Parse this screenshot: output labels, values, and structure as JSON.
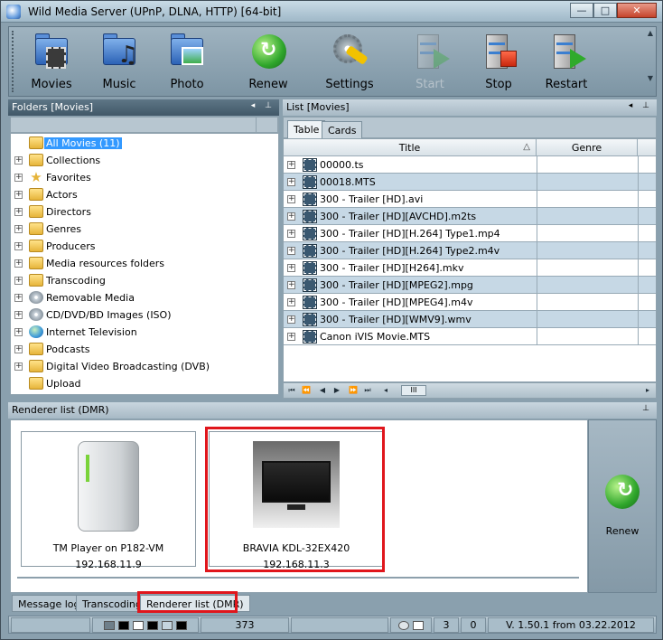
{
  "window": {
    "title": "Wild Media Server (UPnP, DLNA, HTTP) [64-bit]",
    "controls": {
      "minimize": "—",
      "maximize": "□",
      "close": "✕"
    }
  },
  "toolbar": {
    "buttons": [
      {
        "label": "Movies",
        "icon": "movies-folder-icon",
        "enabled": true
      },
      {
        "label": "Music",
        "icon": "music-folder-icon",
        "enabled": true
      },
      {
        "label": "Photo",
        "icon": "photo-folder-icon",
        "enabled": true
      },
      {
        "label": "Renew",
        "icon": "renew-icon",
        "enabled": true
      },
      {
        "label": "Settings",
        "icon": "settings-icon",
        "enabled": true
      },
      {
        "label": "Start",
        "icon": "server-start-icon",
        "enabled": false
      },
      {
        "label": "Stop",
        "icon": "server-stop-icon",
        "enabled": true
      },
      {
        "label": "Restart",
        "icon": "server-restart-icon",
        "enabled": true
      }
    ]
  },
  "folders": {
    "header": "Folders [Movies]",
    "items": [
      {
        "label": "All Movies (11)",
        "icon": "folder-open-icon",
        "selected": true,
        "expandable": false
      },
      {
        "label": "Collections",
        "icon": "folder-icon",
        "expandable": true
      },
      {
        "label": "Favorites",
        "icon": "star-icon",
        "expandable": true
      },
      {
        "label": "Actors",
        "icon": "folder-icon",
        "expandable": true
      },
      {
        "label": "Directors",
        "icon": "folder-icon",
        "expandable": true
      },
      {
        "label": "Genres",
        "icon": "folder-icon",
        "expandable": true
      },
      {
        "label": "Producers",
        "icon": "folder-icon",
        "expandable": true
      },
      {
        "label": "Media resources folders",
        "icon": "folder-icon",
        "expandable": true
      },
      {
        "label": "Transcoding",
        "icon": "folder-icon",
        "expandable": true
      },
      {
        "label": "Removable Media",
        "icon": "removable-media-icon",
        "expandable": true
      },
      {
        "label": "CD/DVD/BD Images (ISO)",
        "icon": "disc-icon",
        "expandable": true
      },
      {
        "label": "Internet Television",
        "icon": "globe-icon",
        "expandable": true
      },
      {
        "label": "Podcasts",
        "icon": "folder-icon",
        "expandable": true
      },
      {
        "label": "Digital Video Broadcasting (DVB)",
        "icon": "folder-icon",
        "expandable": true
      },
      {
        "label": "Upload",
        "icon": "folder-icon",
        "expandable": false
      }
    ]
  },
  "list": {
    "header": "List [Movies]",
    "tabs": [
      {
        "label": "Table",
        "active": true
      },
      {
        "label": "Cards",
        "active": false
      }
    ],
    "columns": [
      "Title",
      "Genre"
    ],
    "sort_indicator": "△",
    "rows": [
      "00000.ts",
      "00018.MTS",
      "300 - Trailer [HD].avi",
      "300 - Trailer [HD][AVCHD].m2ts",
      "300 - Trailer [HD][H.264] Type1.mp4",
      "300 - Trailer [HD][H.264] Type2.m4v",
      "300 - Trailer [HD][H264].mkv",
      "300 - Trailer [HD][MPEG2].mpg",
      "300 - Trailer [HD][MPEG4].m4v",
      "300 - Trailer [HD][WMV9].wmv",
      "Canon iVIS Movie.MTS"
    ],
    "nav": {
      "first": "⏮",
      "prev_page": "⏪",
      "prev": "◀",
      "next": "▶",
      "next_page": "⏩",
      "last": "⏭",
      "scroll_left": "◂",
      "scroll_thumb": "III",
      "scroll_right": "▸"
    }
  },
  "renderers": {
    "header": "Renderer list (DMR)",
    "devices": [
      {
        "name": "TM Player on P182-VM",
        "ip": "192.168.11.9",
        "icon": "media-server-device-icon"
      },
      {
        "name": "BRAVIA KDL-32EX420",
        "ip": "192.168.11.3",
        "icon": "tv-device-icon"
      }
    ],
    "renew_label": "Renew"
  },
  "bottom_tabs": [
    {
      "label": "Message log",
      "active": false
    },
    {
      "label": "Transcoding",
      "active": false
    },
    {
      "label": "Renderer list (DMR)",
      "active": true
    }
  ],
  "status": {
    "count": "373",
    "value_a": "3",
    "value_b": "0",
    "version": "V. 1.50.1 from 03.22.2012"
  },
  "colors": {
    "accent_red": "#e0161c",
    "selection_blue": "#3399ff",
    "row_alt": "#c6d8e5",
    "panel_dark": "#415868"
  }
}
